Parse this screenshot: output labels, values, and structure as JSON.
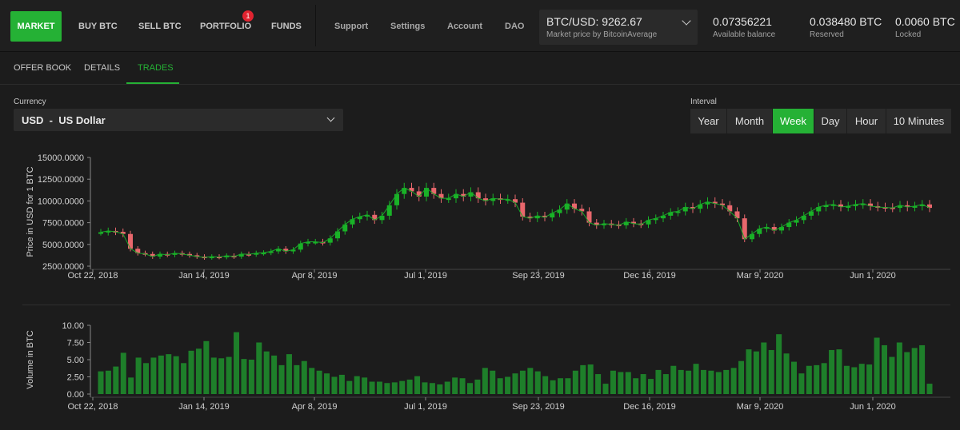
{
  "nav": {
    "items": [
      {
        "label": "MARKET",
        "active": true
      },
      {
        "label": "BUY BTC"
      },
      {
        "label": "SELL BTC"
      },
      {
        "label": "PORTFOLIO",
        "badge": "1"
      },
      {
        "label": "FUNDS"
      }
    ],
    "secondary": [
      {
        "label": "Support"
      },
      {
        "label": "Settings"
      },
      {
        "label": "Account"
      },
      {
        "label": "DAO"
      }
    ]
  },
  "market_price": {
    "value": "BTC/USD: 9262.67",
    "label": "Market price by BitcoinAverage"
  },
  "balances": [
    {
      "value": "0.07356221",
      "label": "Available balance"
    },
    {
      "value": "0.038480 BTC",
      "label": "Reserved"
    },
    {
      "value": "0.0060 BTC",
      "label": "Locked"
    }
  ],
  "tabs": [
    {
      "label": "OFFER BOOK"
    },
    {
      "label": "DETAILS"
    },
    {
      "label": "TRADES",
      "active": true
    }
  ],
  "currency": {
    "label": "Currency",
    "value": "USD  -  US Dollar"
  },
  "interval": {
    "label": "Interval",
    "options": [
      "Year",
      "Month",
      "Week",
      "Day",
      "Hour",
      "10 Minutes"
    ],
    "selected": "Week"
  },
  "colors": {
    "accent": "#25b135",
    "up": "#19b227",
    "down": "#e8676c",
    "badge": "#e12430",
    "volume": "#1e7f2a"
  },
  "chart_data": [
    {
      "type": "candlestick",
      "ylabel": "Price in USD for 1 BTC",
      "ylim": [
        2500,
        15000
      ],
      "yticks": [
        "15000.0000",
        "12500.0000",
        "10000.0000",
        "7500.0000",
        "5000.0000",
        "2500.0000"
      ],
      "ytick_values": [
        15000,
        12500,
        10000,
        7500,
        5000,
        2500
      ],
      "xticks": [
        "Oct 22, 2018",
        "Jan 14, 2019",
        "Apr 8, 2019",
        "Jul 1, 2019",
        "Sep 23, 2019",
        "Dec 16, 2019",
        "Mar 9, 2020",
        "Jun 1, 2020"
      ],
      "close": [
        6400,
        6550,
        6450,
        6200,
        4500,
        4000,
        3900,
        3600,
        3900,
        3800,
        4000,
        3900,
        3750,
        3600,
        3500,
        3600,
        3550,
        3700,
        3600,
        3900,
        3850,
        4000,
        4050,
        4200,
        4500,
        4200,
        4400,
        5100,
        5300,
        5300,
        5200,
        5700,
        6500,
        7300,
        7900,
        8200,
        8400,
        7800,
        8300,
        9500,
        10800,
        11500,
        11100,
        10500,
        11500,
        10800,
        10300,
        10300,
        10800,
        10500,
        11000,
        10300,
        10000,
        10300,
        10200,
        10200,
        9800,
        8200,
        8000,
        8300,
        8100,
        8600,
        9000,
        9700,
        9100,
        8800,
        7500,
        7200,
        7400,
        7300,
        7200,
        7600,
        7400,
        7300,
        7800,
        8000,
        8300,
        8700,
        8800,
        9300,
        9100,
        9600,
        9900,
        9700,
        9500,
        8800,
        8000,
        5600,
        6200,
        6800,
        7000,
        6600,
        7000,
        7500,
        7800,
        8300,
        8800,
        9300,
        9500,
        9600,
        9300,
        9400,
        9600,
        9700,
        9400,
        9300,
        9250,
        9200,
        9500,
        9300,
        9400,
        9600,
        9200
      ],
      "volume": [
        3.3,
        3.4,
        4.0,
        6.0,
        2.4,
        5.3,
        4.5,
        5.3,
        5.6,
        5.8,
        5.5,
        4.5,
        6.3,
        6.6,
        7.7,
        5.3,
        5.2,
        5.4,
        9.0,
        5.1,
        5.0,
        7.5,
        6.2,
        5.6,
        4.2,
        5.8,
        4.2,
        4.8,
        3.8,
        3.4,
        3.0,
        2.5,
        2.8,
        1.9,
        2.6,
        2.4,
        1.8,
        1.8,
        1.6,
        1.7,
        1.9,
        2.1,
        2.6,
        1.7,
        1.6,
        1.4,
        1.8,
        2.4,
        2.3,
        1.6,
        2.1,
        3.8,
        3.4,
        2.3,
        2.5,
        3.0,
        3.4,
        3.8,
        3.3,
        2.6,
        2.0,
        2.3,
        2.3,
        3.4,
        4.2,
        4.3,
        2.9,
        1.5,
        3.4,
        3.2,
        3.2,
        2.3,
        2.9,
        2.2,
        3.5,
        2.9,
        4.1,
        3.5,
        3.4,
        4.4,
        3.5,
        3.4,
        3.2,
        3.5,
        3.8,
        4.8,
        6.5,
        6.2,
        7.5,
        6.4,
        8.7,
        5.9,
        4.7,
        3.0,
        4.1,
        4.2,
        4.5,
        6.4,
        6.5,
        4.1,
        3.9,
        4.4,
        4.3,
        8.2,
        7.1,
        5.4,
        7.5,
        6.1,
        6.7,
        7.1,
        1.5
      ]
    },
    {
      "type": "bar",
      "ylabel": "Volume in BTC",
      "ylim": [
        0,
        10
      ],
      "yticks": [
        "10.00",
        "7.50",
        "5.00",
        "2.50",
        "0.00"
      ],
      "ytick_values": [
        10,
        7.5,
        5,
        2.5,
        0
      ],
      "xticks": [
        "Oct 22, 2018",
        "Jan 14, 2019",
        "Apr 8, 2019",
        "Jul 1, 2019",
        "Sep 23, 2019",
        "Dec 16, 2019",
        "Mar 9, 2020",
        "Jun 1, 2020"
      ]
    }
  ]
}
